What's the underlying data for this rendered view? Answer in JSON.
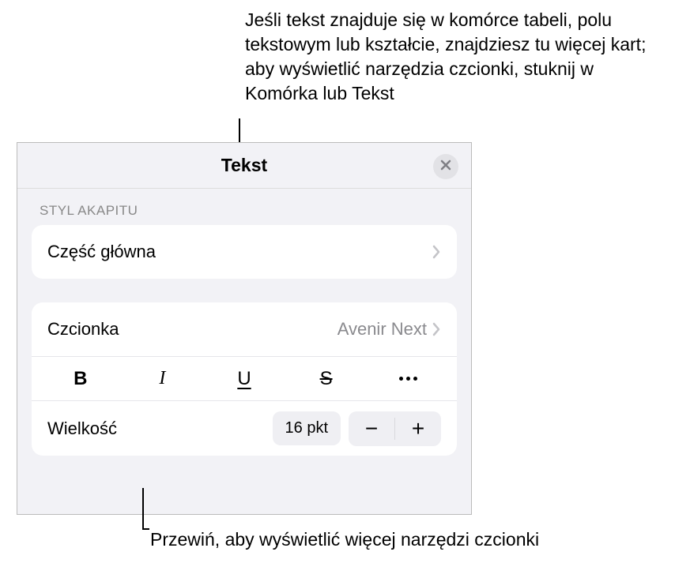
{
  "annotations": {
    "top": "Jeśli tekst znajduje się w komórce tabeli, polu tekstowym lub kształcie, znajdziesz tu więcej kart; aby wyświetlić narzędzia czcionki, stuknij w Komórka lub Tekst",
    "bottom": "Przewiń, aby wyświetlić więcej narzędzi czcionki"
  },
  "panel": {
    "title": "Tekst",
    "section_label": "STYL AKAPITU",
    "paragraph_style": "Część główna",
    "font_label": "Czcionka",
    "font_value": "Avenir Next",
    "formats": {
      "bold": "B",
      "italic": "I",
      "underline": "U",
      "strike": "S"
    },
    "size_label": "Wielkość",
    "size_value": "16 pkt",
    "minus": "−",
    "plus": "+"
  }
}
